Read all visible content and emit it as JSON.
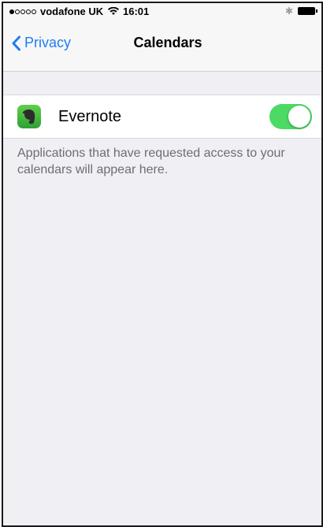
{
  "status_bar": {
    "carrier": "vodafone UK",
    "time": "16:01",
    "signal_filled": 1,
    "signal_total": 5
  },
  "nav": {
    "back_label": "Privacy",
    "title": "Calendars"
  },
  "apps": [
    {
      "name": "Evernote",
      "enabled": true,
      "icon": "evernote-icon"
    }
  ],
  "footer": {
    "text": "Applications that have requested access to your calendars will appear here."
  },
  "colors": {
    "accent": "#1f7cf3",
    "toggle_on": "#4cd964",
    "background": "#efeff4"
  }
}
